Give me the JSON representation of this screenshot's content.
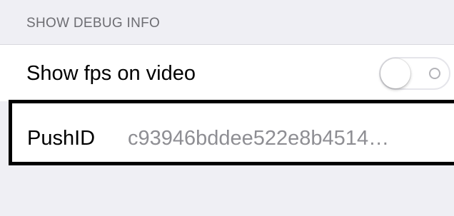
{
  "section": {
    "header": "SHOW DEBUG INFO"
  },
  "fps_cell": {
    "label": "Show fps on video",
    "toggle_on": false
  },
  "push_cell": {
    "label": "PushID",
    "value": "c93946bddee522e8b4514…"
  },
  "colors": {
    "background": "#efeff4",
    "header_text": "#6d6d72",
    "value_text": "#8e8e93",
    "highlight_border": "#000000"
  }
}
